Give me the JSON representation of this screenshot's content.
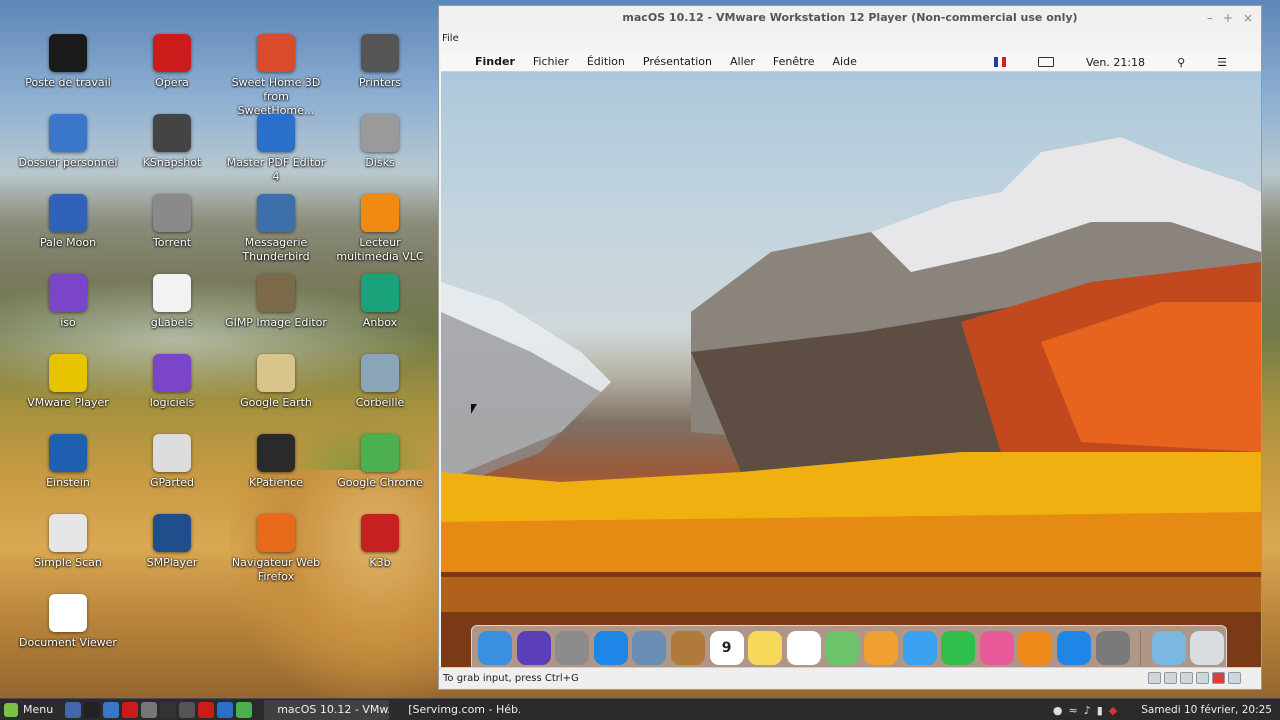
{
  "desktop": {
    "icons": [
      {
        "label": "Poste de travail",
        "icon": "monitor-icon",
        "color": "#1a1a1a"
      },
      {
        "label": "Opera",
        "icon": "opera-icon",
        "color": "#cc1b1b"
      },
      {
        "label": "Sweet Home 3D from SweetHome...",
        "icon": "sweethome3d-icon",
        "color": "#d94b2b"
      },
      {
        "label": "Printers",
        "icon": "printer-icon",
        "color": "#555555"
      },
      {
        "label": "Dossier personnel",
        "icon": "home-folder-icon",
        "color": "#3b77c9"
      },
      {
        "label": "KSnapshot",
        "icon": "camera-icon",
        "color": "#444444"
      },
      {
        "label": "Master PDF Editor 4",
        "icon": "pdf-editor-icon",
        "color": "#2a6fc9"
      },
      {
        "label": "Disks",
        "icon": "disk-icon",
        "color": "#9a9a9a"
      },
      {
        "label": "Pale Moon",
        "icon": "palemoon-icon",
        "color": "#2f62b8"
      },
      {
        "label": "Torrent",
        "icon": "torrent-icon",
        "color": "#8a8a8a"
      },
      {
        "label": "Messagerie Thunderbird",
        "icon": "thunderbird-icon",
        "color": "#3d6fa8"
      },
      {
        "label": "Lecteur multimédia VLC",
        "icon": "vlc-icon",
        "color": "#f08a10"
      },
      {
        "label": "iso",
        "icon": "folder-icon",
        "color": "#7b45c9"
      },
      {
        "label": "gLabels",
        "icon": "document-icon",
        "color": "#f2f2f2"
      },
      {
        "label": "GIMP Image Editor",
        "icon": "gimp-icon",
        "color": "#7c6a4a"
      },
      {
        "label": "Anbox",
        "icon": "android-icon",
        "color": "#1aa37a"
      },
      {
        "label": "VMware Player",
        "icon": "vmware-icon",
        "color": "#e8c300"
      },
      {
        "label": "logiciels",
        "icon": "folder-icon",
        "color": "#7b45c9"
      },
      {
        "label": "Google Earth",
        "icon": "earth-icon",
        "color": "#d9c48a"
      },
      {
        "label": "Corbeille",
        "icon": "trash-icon",
        "color": "#8aa4b8"
      },
      {
        "label": "Einstein",
        "icon": "einstein-icon",
        "color": "#1f5fb0"
      },
      {
        "label": "GParted",
        "icon": "gparted-icon",
        "color": "#dddddd"
      },
      {
        "label": "KPatience",
        "icon": "cards-icon",
        "color": "#2a2a2a"
      },
      {
        "label": "Google Chrome",
        "icon": "chrome-icon",
        "color": "#4caf50"
      },
      {
        "label": "Simple Scan",
        "icon": "scanner-icon",
        "color": "#e6e6e6"
      },
      {
        "label": "SMPlayer",
        "icon": "smplayer-icon",
        "color": "#1e4e8c"
      },
      {
        "label": "Navigateur Web Firefox",
        "icon": "firefox-icon",
        "color": "#e66a1a"
      },
      {
        "label": "K3b",
        "icon": "k3b-icon",
        "color": "#c62020"
      },
      {
        "label": "Document Viewer",
        "icon": "document-viewer-icon",
        "color": "#ffffff"
      }
    ]
  },
  "vm_window": {
    "title": "macOS 10.12 - VMware Workstation 12 Player (Non-commercial use only)",
    "menu": "File",
    "status": "To grab input, press Ctrl+G",
    "controls": [
      "–",
      "+",
      "×"
    ]
  },
  "mac": {
    "menus": [
      "Finder",
      "Fichier",
      "Édition",
      "Présentation",
      "Aller",
      "Fenêtre",
      "Aide"
    ],
    "clock": "Ven. 21:18",
    "flag_label": "FR",
    "dock": [
      {
        "name": "finder-icon",
        "color": "#3a8fe0"
      },
      {
        "name": "siri-icon",
        "color": "#5b3fb8"
      },
      {
        "name": "launchpad-icon",
        "color": "#8c8c8c"
      },
      {
        "name": "safari-icon",
        "color": "#1e86e6"
      },
      {
        "name": "preview-icon",
        "color": "#6a8db5"
      },
      {
        "name": "contacts-icon",
        "color": "#b07a3a"
      },
      {
        "name": "calendar-icon",
        "color": "#ffffff",
        "text": "9"
      },
      {
        "name": "notes-icon",
        "color": "#f6d85a"
      },
      {
        "name": "reminders-icon",
        "color": "#ffffff"
      },
      {
        "name": "maps-icon",
        "color": "#6cc36a"
      },
      {
        "name": "photos-icon",
        "color": "#f0a030"
      },
      {
        "name": "messages-icon",
        "color": "#3aa0f0"
      },
      {
        "name": "facetime-icon",
        "color": "#2fbf4a"
      },
      {
        "name": "itunes-icon",
        "color": "#e85a9a"
      },
      {
        "name": "ibooks-icon",
        "color": "#f08a1a"
      },
      {
        "name": "app-store-icon",
        "color": "#1e86e6"
      },
      {
        "name": "system-preferences-icon",
        "color": "#7a7a7a"
      },
      {
        "name": "downloads-icon",
        "color": "#7ab8e0"
      },
      {
        "name": "dock-trash-icon",
        "color": "#d8dde2"
      }
    ]
  },
  "taskbar": {
    "menu_label": "Menu",
    "tasks": [
      "macOS 10.12 - VMw...",
      "[Servimg.com - Héb..."
    ],
    "clock": "Samedi 10 février, 20:25",
    "quick": [
      "#4466aa",
      "#222222",
      "#3b77c9",
      "#cc1b1b",
      "#777777",
      "#333333",
      "#555555",
      "#cc1b1b",
      "#2a6fc9",
      "#4caf50"
    ]
  }
}
